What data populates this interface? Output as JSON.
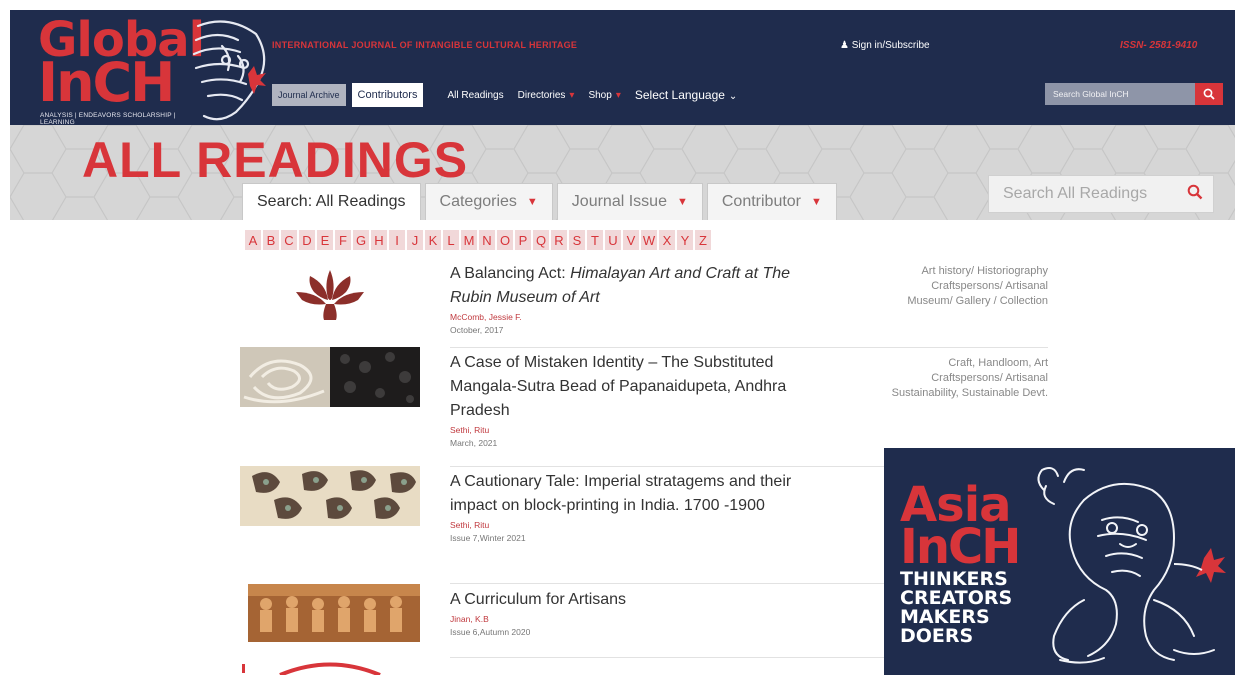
{
  "header": {
    "logo_line1": "Global",
    "logo_line2": "InCH",
    "logo_tagline": "ANALYSIS | ENDEAVORS SCHOLARSHIP | LEARNING",
    "journal_title": "INTERNATIONAL JOURNAL OF INTANGIBLE CULTURAL HERITAGE",
    "signin": "Sign in/Subscribe",
    "issn": "ISSN- 2581-9410",
    "search_placeholder": "Search Global InCH",
    "nav": [
      {
        "label": "Journal Archive"
      },
      {
        "label": "Contributors"
      },
      {
        "label": "All Readings"
      },
      {
        "label": "Directories"
      },
      {
        "label": "Shop"
      },
      {
        "label": "Select Language"
      }
    ]
  },
  "banner": {
    "title": "ALL READINGS",
    "tabs": [
      {
        "label": "Search: All Readings"
      },
      {
        "label": "Categories"
      },
      {
        "label": "Journal Issue"
      },
      {
        "label": "Contributor"
      }
    ],
    "search_placeholder": "Search All Readings"
  },
  "alphabet": [
    "A",
    "B",
    "C",
    "D",
    "E",
    "F",
    "G",
    "H",
    "I",
    "J",
    "K",
    "L",
    "M",
    "N",
    "O",
    "P",
    "Q",
    "R",
    "S",
    "T",
    "U",
    "V",
    "W",
    "X",
    "Y",
    "Z"
  ],
  "readings": [
    {
      "title_plain": "A Balancing Act: ",
      "title_italic": "Himalayan Art and Craft at The Rubin Museum of Art",
      "author": "McComb, Jessie F.",
      "date": "October, 2017",
      "categories": [
        "Art history/ Historiography",
        "Craftspersons/ Artisanal",
        "Museum/ Gallery / Collection"
      ]
    },
    {
      "title_plain": "A Case of Mistaken Identity – The Substituted Mangala-Sutra Bead of Papanaidupeta, Andhra Pradesh",
      "title_italic": "",
      "author": "Sethi, Ritu",
      "date": "March, 2021",
      "categories": [
        "Craft, Handloom, Art",
        "Craftspersons/ Artisanal",
        "Sustainability, Sustainable Devt."
      ]
    },
    {
      "title_plain": "A Cautionary Tale: Imperial stratagems and their impact on block-printing in India. 1700 -1900",
      "title_italic": "",
      "author": "Sethi, Ritu",
      "date": "Issue 7,Winter 2021",
      "categories": []
    },
    {
      "title_plain": "A Curriculum for Artisans",
      "title_italic": "",
      "author": "Jinan, K.B",
      "date": "Issue 6,Autumn 2020",
      "categories": []
    }
  ],
  "overlay": {
    "line1": "Asia",
    "line2": "InCH",
    "words": [
      "THINKERS",
      "CREATORS",
      "MAKERS",
      "DOERS"
    ]
  },
  "colors": {
    "navy": "#1f2c4d",
    "brand_red": "#d8353a",
    "banner_grey": "#d6d6d6"
  }
}
